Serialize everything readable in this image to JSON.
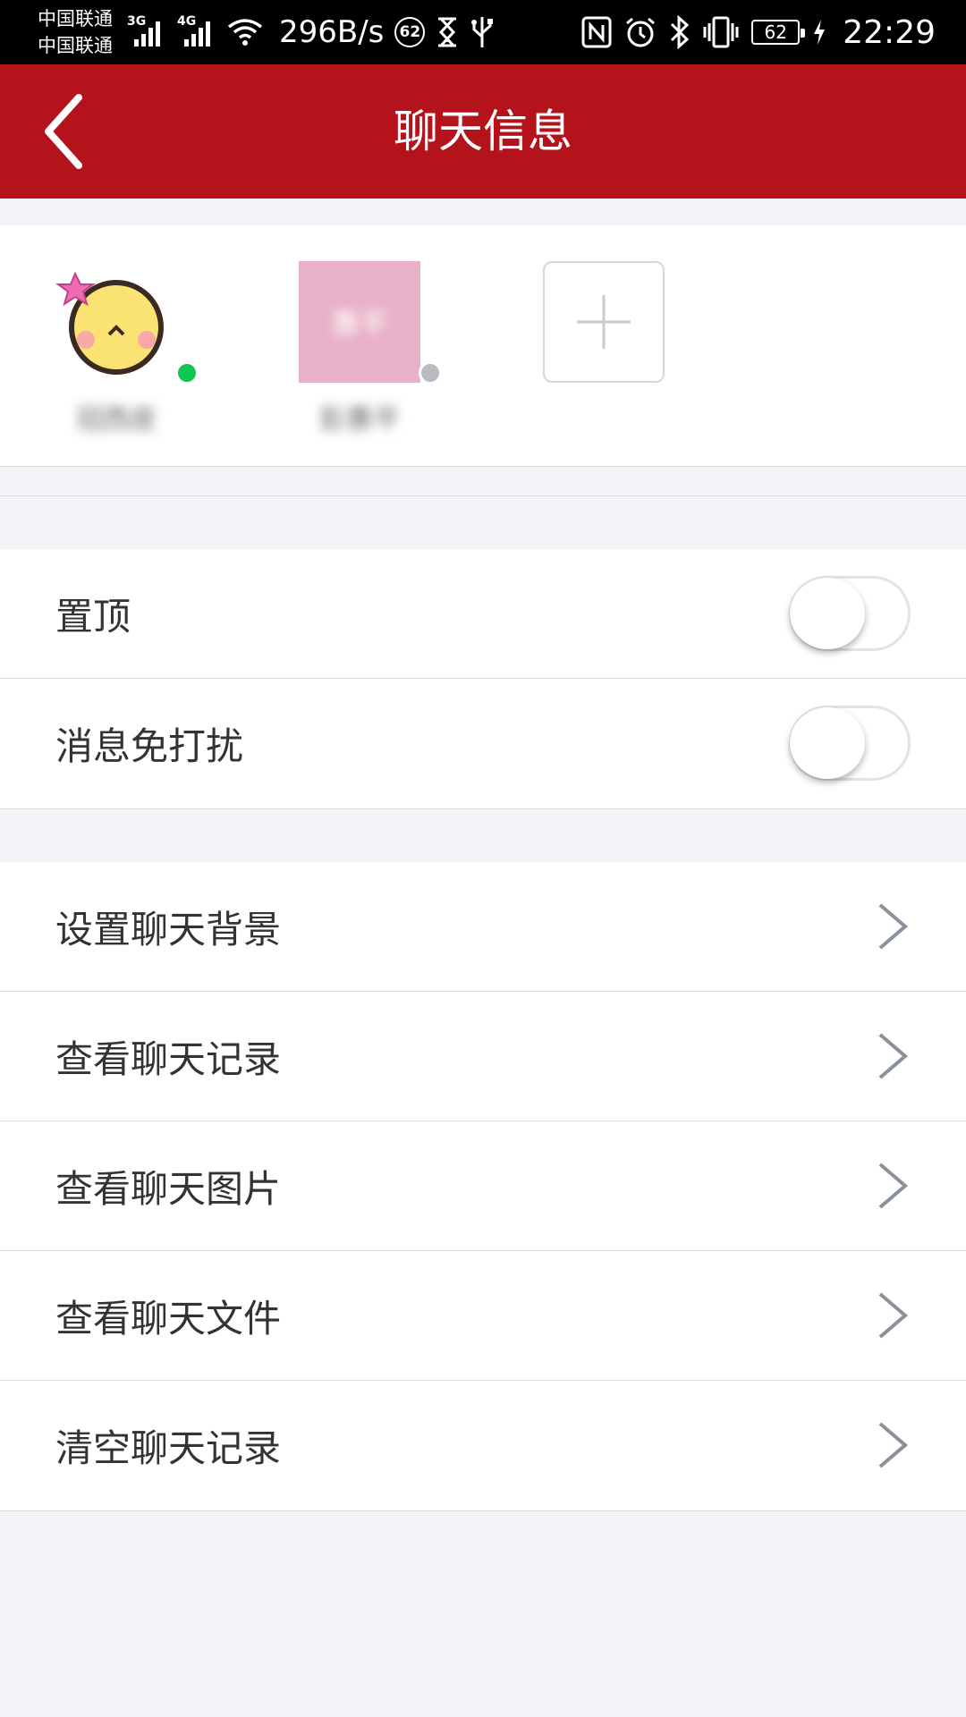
{
  "status_bar": {
    "carrier_1": "中国联通",
    "carrier_2": "中国联通",
    "net_type_1": "3G",
    "net_type_2": "4G",
    "speed": "296B/s",
    "notification_badge": "62",
    "battery": "62",
    "time": "22:29"
  },
  "header": {
    "title": "聊天信息"
  },
  "members": [
    {
      "name": "冠西皮",
      "status": "online",
      "avatar": "chick-emoji"
    },
    {
      "name": "彭惠平",
      "avatar_text": "惠平",
      "status": "offline",
      "avatar": "pink-square"
    }
  ],
  "toggles": [
    {
      "label": "置顶",
      "on": false
    },
    {
      "label": "消息免打扰",
      "on": false
    }
  ],
  "menu": [
    {
      "label": "设置聊天背景"
    },
    {
      "label": "查看聊天记录"
    },
    {
      "label": "查看聊天图片"
    },
    {
      "label": "查看聊天文件"
    },
    {
      "label": "清空聊天记录"
    }
  ],
  "colors": {
    "header_bg": "#b4131b",
    "page_bg": "#f3f4f8",
    "online": "#10c64f",
    "offline": "#b8bcc2"
  }
}
